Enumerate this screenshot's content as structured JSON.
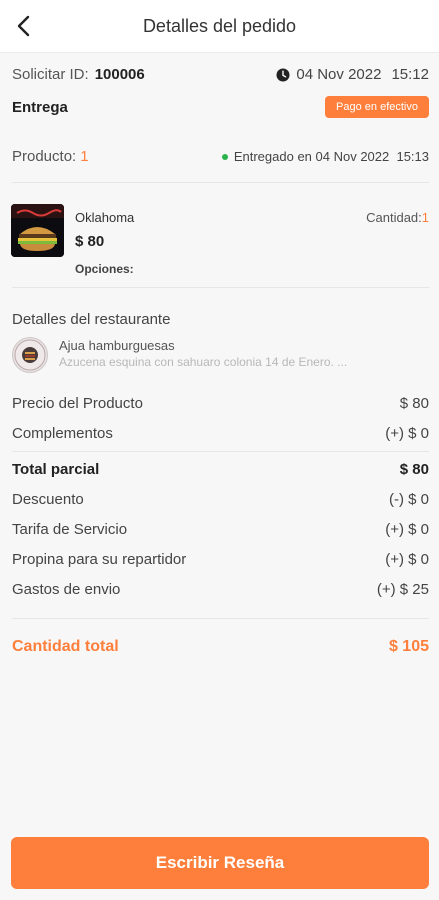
{
  "header": {
    "title": "Detalles del pedido",
    "back_icon": "chevron-left-icon"
  },
  "order": {
    "id_label": "Solicitar ID:",
    "id_value": "100006",
    "date": "04 Nov 2022",
    "time": "15:12",
    "type": "Entrega",
    "payment_badge": "Pago en efectivo",
    "product_label": "Producto:",
    "product_count": "1",
    "delivered_text": "Entregado en 04 Nov 2022  15:13"
  },
  "item": {
    "name": "Oklahoma",
    "price": "$ 80",
    "options_label": "Opciones:",
    "qty_label": "Cantidad:",
    "qty_value": "1"
  },
  "restaurant": {
    "section_title": "Detalles del restaurante",
    "name": "Ajua hamburguesas",
    "address": "Azucena esquina con sahuaro colonia 14 de Enero. ..."
  },
  "summary": {
    "lines": [
      {
        "label": "Precio del Producto",
        "value": "$ 80"
      },
      {
        "label": "Complementos",
        "value": "(+) $ 0"
      },
      {
        "label": "Total parcial",
        "value": "$ 80"
      },
      {
        "label": "Descuento",
        "value": "(-) $ 0"
      },
      {
        "label": "Tarifa de Servicio",
        "value": "(+) $ 0"
      },
      {
        "label": "Propina para su repartidor",
        "value": "(+) $ 0"
      },
      {
        "label": "Gastos de envio",
        "value": "(+) $ 25"
      }
    ],
    "total_label": "Cantidad total",
    "total_value": "$ 105"
  },
  "actions": {
    "review_button": "Escribir Reseña"
  },
  "colors": {
    "accent": "#fe7f3b",
    "status_green": "#29b34a"
  }
}
